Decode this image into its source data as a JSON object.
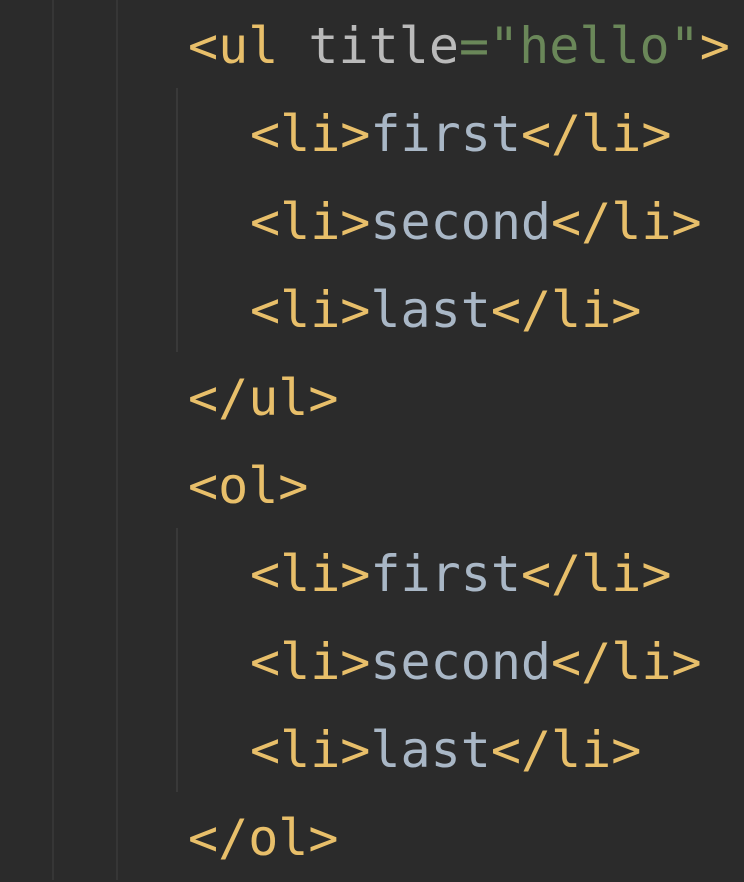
{
  "editor": {
    "lines": [
      {
        "indent": 1,
        "parts": [
          {
            "kind": "tag",
            "text": "<ul"
          },
          {
            "kind": "space",
            "text": " "
          },
          {
            "kind": "attr",
            "text": "title"
          },
          {
            "kind": "eq",
            "text": "="
          },
          {
            "kind": "str",
            "text": "\"hello\""
          },
          {
            "kind": "tag",
            "text": ">"
          }
        ]
      },
      {
        "indent": 2,
        "parts": [
          {
            "kind": "tag",
            "text": "<li>"
          },
          {
            "kind": "txt",
            "text": "first"
          },
          {
            "kind": "tag",
            "text": "</li>"
          }
        ]
      },
      {
        "indent": 2,
        "parts": [
          {
            "kind": "tag",
            "text": "<li>"
          },
          {
            "kind": "txt",
            "text": "second"
          },
          {
            "kind": "tag",
            "text": "</li>"
          }
        ]
      },
      {
        "indent": 2,
        "parts": [
          {
            "kind": "tag",
            "text": "<li>"
          },
          {
            "kind": "txt",
            "text": "last"
          },
          {
            "kind": "tag",
            "text": "</li>"
          }
        ]
      },
      {
        "indent": 1,
        "parts": [
          {
            "kind": "tag",
            "text": "</ul>"
          }
        ]
      },
      {
        "indent": 1,
        "parts": [
          {
            "kind": "tag",
            "text": "<ol>"
          }
        ]
      },
      {
        "indent": 2,
        "parts": [
          {
            "kind": "tag",
            "text": "<li>"
          },
          {
            "kind": "txt",
            "text": "first"
          },
          {
            "kind": "tag",
            "text": "</li>"
          }
        ]
      },
      {
        "indent": 2,
        "parts": [
          {
            "kind": "tag",
            "text": "<li>"
          },
          {
            "kind": "txt",
            "text": "second"
          },
          {
            "kind": "tag",
            "text": "</li>"
          }
        ]
      },
      {
        "indent": 2,
        "parts": [
          {
            "kind": "tag",
            "text": "<li>"
          },
          {
            "kind": "txt",
            "text": "last"
          },
          {
            "kind": "tag",
            "text": "</li>"
          }
        ]
      },
      {
        "indent": 1,
        "parts": [
          {
            "kind": "tag",
            "text": "</ol>"
          }
        ]
      }
    ]
  },
  "colors": {
    "background": "#2b2b2b",
    "tag": "#e8bf6a",
    "attribute": "#bababa",
    "string": "#6a8759",
    "text": "#a9b7c6",
    "indent_guide": "#363636"
  }
}
